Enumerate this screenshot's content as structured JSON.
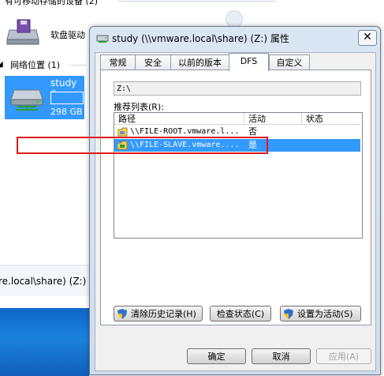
{
  "explorer": {
    "removable_header": "有可移动存储的设备 (2)",
    "floppy_label": "软盘驱动",
    "network_header": "网络位置 (1)",
    "net_drive_name": "study (\\",
    "net_drive_size": "298 GB",
    "status_path": "re.local\\share) (Z:)"
  },
  "dialog": {
    "title": "study (\\\\vmware.local\\share) (Z:) 属性",
    "close_glyph": "✕",
    "tabs": [
      "常规",
      "安全",
      "以前的版本",
      "DFS",
      "自定义"
    ],
    "selected_tab": "DFS",
    "path_value": "Z:\\",
    "referral_label": "推荐列表(R):",
    "columns": [
      "路径",
      "活动",
      "状态"
    ],
    "rows": [
      {
        "path": "\\\\FILE-ROOT.vmware.l...",
        "active": "否"
      },
      {
        "path": "\\\\FILE-SLAVE.vmware....",
        "active": "是"
      }
    ],
    "actions": {
      "clear_history": "清除历史记录(H)",
      "check_status": "检查状态(C)",
      "set_active": "设置为活动(S)"
    },
    "footer": {
      "ok": "确定",
      "cancel": "取消",
      "apply": "应用(A)"
    }
  },
  "colors": {
    "selection": "#3399ff",
    "highlight_border": "#e01818",
    "taskbar": "#1b82dc"
  },
  "icons": [
    "floppy-drive-icon",
    "network-drive-icon",
    "properties-icon",
    "uac-shield-icon",
    "dfs-folder-icon"
  ]
}
